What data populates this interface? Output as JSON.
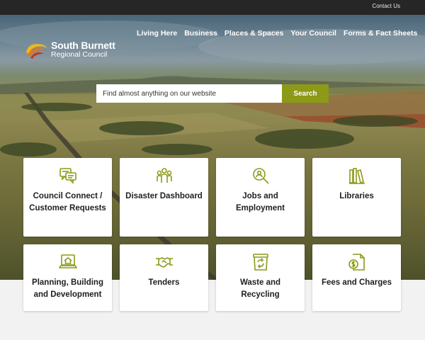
{
  "topbar": {
    "contact_label": "Contact Us"
  },
  "logo": {
    "name": "South Burnett",
    "subtitle": "Regional Council"
  },
  "nav": {
    "items": [
      "Living Here",
      "Business",
      "Places & Spaces",
      "Your Council",
      "Forms & Fact Sheets"
    ]
  },
  "search": {
    "placeholder": "Find almost anything on our website",
    "button_label": "Search"
  },
  "colors": {
    "accent": "#8c9a18",
    "topbar": "#262626",
    "icon": "#8c9a18"
  },
  "cards": [
    {
      "label": "Council Connect / Customer Requests",
      "icon": "chat-bubbles-icon"
    },
    {
      "label": "Disaster Dashboard",
      "icon": "people-group-icon"
    },
    {
      "label": "Jobs and Employment",
      "icon": "search-person-icon"
    },
    {
      "label": "Libraries",
      "icon": "books-icon"
    },
    {
      "label": "Planning, Building and Development",
      "icon": "house-laptop-icon"
    },
    {
      "label": "Tenders",
      "icon": "handshake-icon"
    },
    {
      "label": "Waste and Recycling",
      "icon": "recycle-bin-icon"
    },
    {
      "label": "Fees and Charges",
      "icon": "dollar-document-icon"
    }
  ]
}
